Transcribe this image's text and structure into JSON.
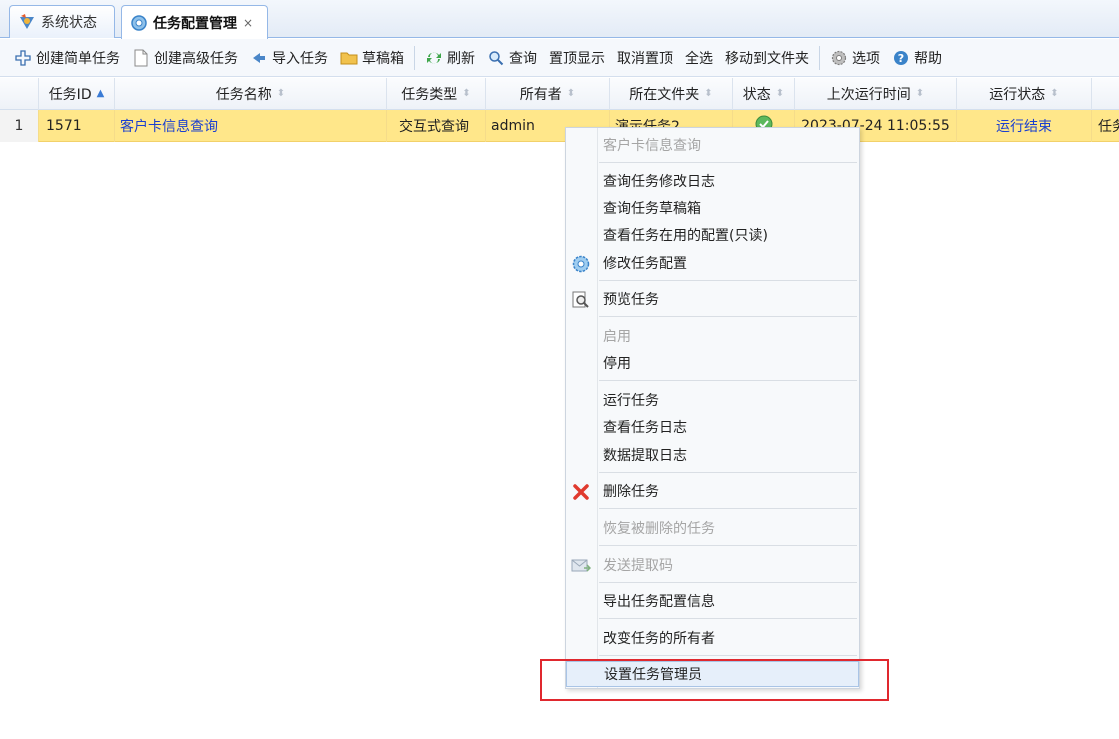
{
  "tabs": [
    {
      "label": "系统状态",
      "icon": "system-status-icon"
    },
    {
      "label": "任务配置管理",
      "icon": "gear-icon",
      "active": true,
      "close": "×"
    }
  ],
  "toolbar": {
    "create_simple": "创建简单任务",
    "create_advanced": "创建高级任务",
    "import": "导入任务",
    "drafts": "草稿箱",
    "refresh": "刷新",
    "query": "查询",
    "pin_top": "置顶显示",
    "unpin": "取消置顶",
    "select_all": "全选",
    "move_to_folder": "移动到文件夹",
    "options": "选项",
    "help": "帮助"
  },
  "grid": {
    "columns": [
      "任务ID",
      "任务名称",
      "任务类型",
      "所有者",
      "所在文件夹",
      "状态",
      "上次运行时间",
      "运行状态"
    ],
    "rows": [
      {
        "num": "1",
        "id": "1571",
        "name": "客户卡信息查询",
        "type": "交互式查询",
        "owner": "admin",
        "folder": "演示任务2",
        "status": "ok",
        "last_run": "2023-07-24 11:05:55",
        "run_status": "运行结束",
        "extra": "任务"
      }
    ]
  },
  "context_menu": {
    "title": "客户卡信息查询",
    "items": {
      "view_change_log": "查询任务修改日志",
      "view_drafts": "查询任务草稿箱",
      "view_active_config": "查看任务在用的配置(只读)",
      "edit_config": "修改任务配置",
      "preview": "预览任务",
      "enable": "启用",
      "disable": "停用",
      "run": "运行任务",
      "view_task_log": "查看任务日志",
      "view_extract_log": "数据提取日志",
      "delete": "删除任务",
      "restore_deleted": "恢复被删除的任务",
      "send_code": "发送提取码",
      "export_config": "导出任务配置信息",
      "change_owner": "改变任务的所有者",
      "set_admin": "设置任务管理员"
    }
  },
  "colors": {
    "selected_row": "#ffe78a",
    "link": "#1a3fd0",
    "highlight_box": "#e0282e"
  }
}
